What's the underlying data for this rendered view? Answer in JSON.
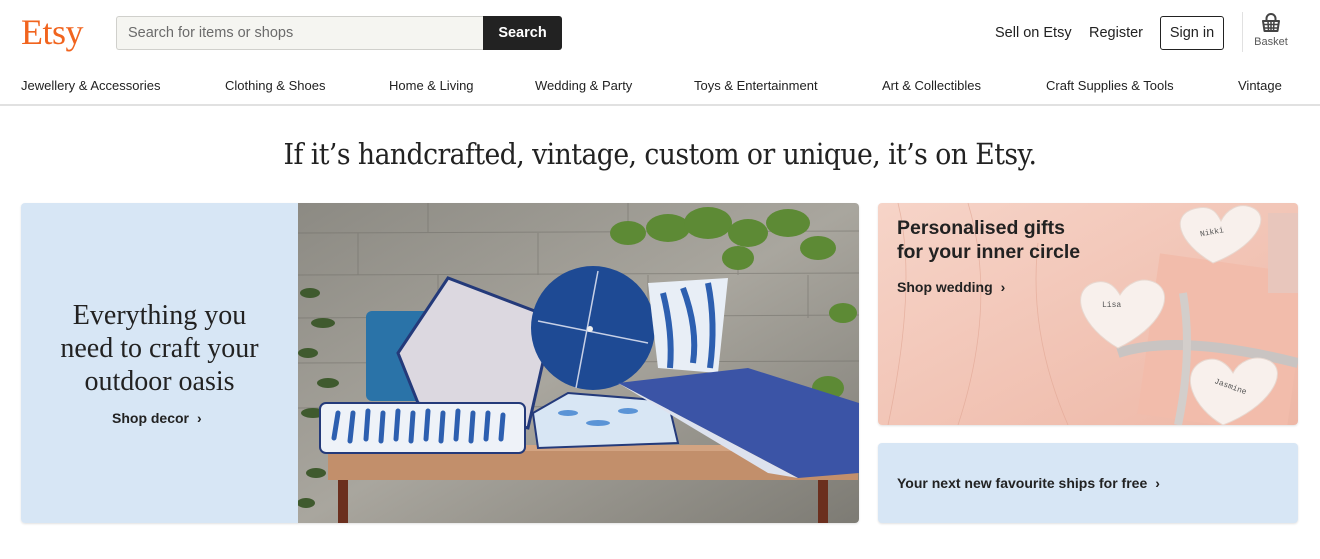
{
  "header": {
    "logo": "Etsy",
    "search": {
      "placeholder": "Search for items or shops",
      "value": "",
      "button_label": "Search"
    },
    "links": {
      "sell": "Sell on Etsy",
      "register": "Register",
      "sign_in": "Sign in"
    },
    "basket": {
      "label": "Basket",
      "icon": "basket-icon"
    }
  },
  "categories": [
    {
      "label": "Jewellery & Accessories"
    },
    {
      "label": "Clothing & Shoes"
    },
    {
      "label": "Home & Living"
    },
    {
      "label": "Wedding & Party"
    },
    {
      "label": "Toys & Entertainment"
    },
    {
      "label": "Art & Collectibles"
    },
    {
      "label": "Craft Supplies & Tools"
    },
    {
      "label": "Vintage"
    }
  ],
  "tagline": "If it’s handcrafted, vintage, custom or unique, it’s on Etsy.",
  "hero": {
    "title_lines": [
      "Everything you",
      "need to craft your",
      "outdoor oasis"
    ],
    "link_label": "Shop decor",
    "image": "outdoor-cushions-on-bench"
  },
  "gifts_card": {
    "title_lines": [
      "Personalised gifts",
      "for your inner circle"
    ],
    "link_label": "Shop wedding",
    "image": "personalised-heart-dishes",
    "dish_names": [
      "Nikki",
      "Lisa",
      "Jasmine"
    ]
  },
  "shipping_card": {
    "link_label": "Your next new favourite ships for free"
  },
  "colors": {
    "brand": "#f1641e",
    "panel_blue": "#d7e6f5",
    "dark": "#222222"
  }
}
